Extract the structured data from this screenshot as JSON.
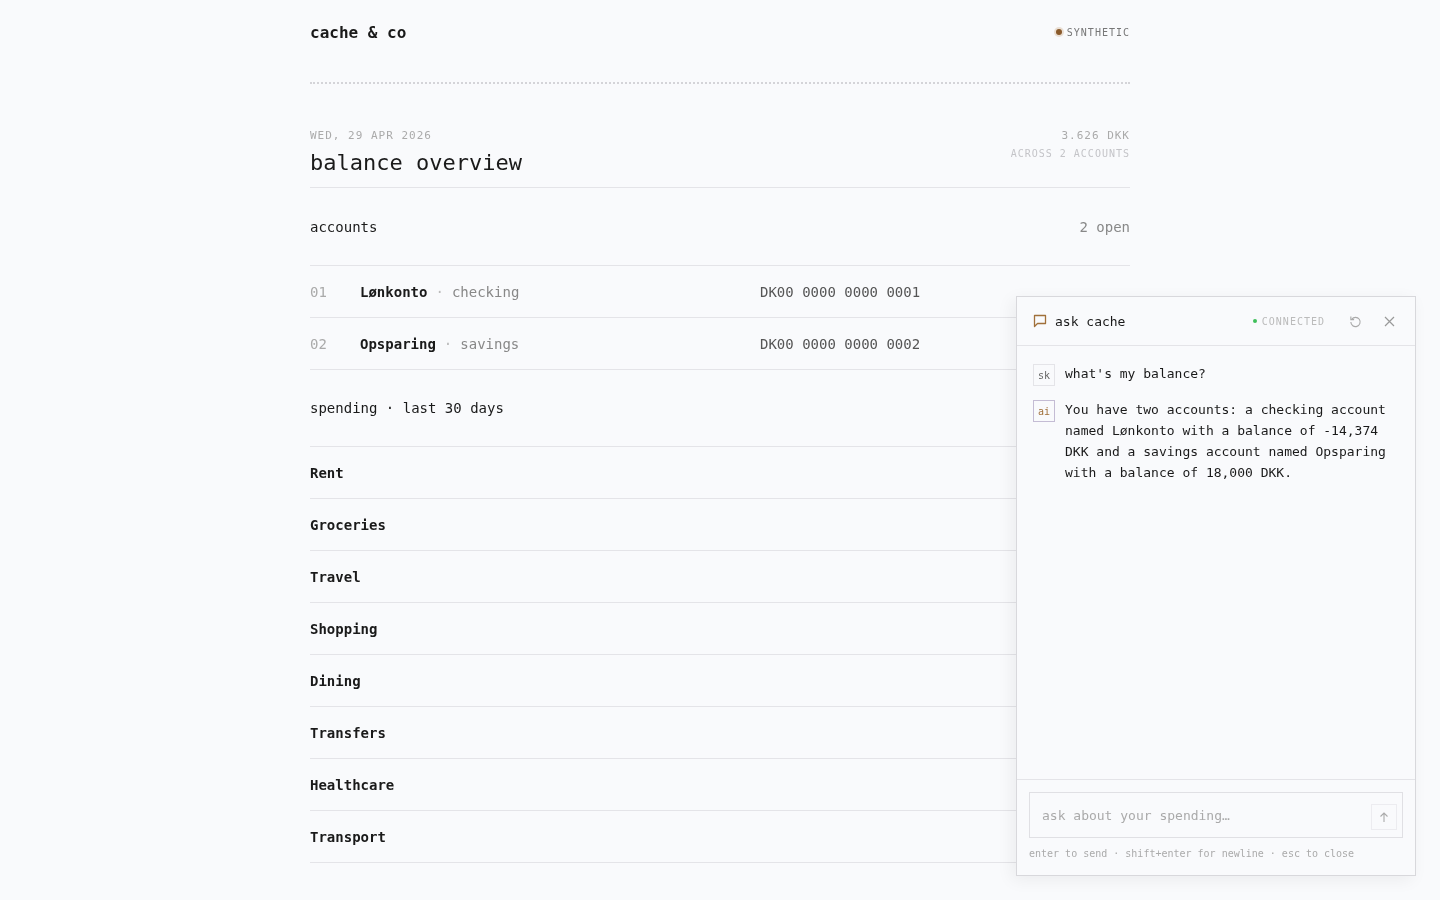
{
  "brand": "cache & co",
  "badge": {
    "label": "SYNTHETIC",
    "color": "#8a5a2b"
  },
  "header": {
    "date": "WED, 29 APR 2026",
    "title": "balance overview",
    "total": "3.626 DKK",
    "total_note": "ACROSS 2 ACCOUNTS"
  },
  "accounts": {
    "title": "accounts",
    "count": "2 open",
    "rows": [
      {
        "number": "01",
        "name": "Lønkonto",
        "separator": "·",
        "type": "checking",
        "iban": "DK00 0000 0000 0001"
      },
      {
        "number": "02",
        "name": "Opsparing",
        "separator": "·",
        "type": "savings",
        "iban": "DK00 0000 0000 0002"
      }
    ]
  },
  "spending": {
    "title": "spending · last 30 days",
    "categories": [
      "Rent",
      "Groceries",
      "Travel",
      "Shopping",
      "Dining",
      "Transfers",
      "Healthcare",
      "Transport"
    ]
  },
  "chat": {
    "title": "ask cache",
    "status": {
      "label": "CONNECTED",
      "color": "#3fbf5a"
    },
    "messages": [
      {
        "kind": "user",
        "avatar": "sk",
        "text": "what's my balance?"
      },
      {
        "kind": "assistant",
        "avatar": "ai",
        "text": "You have two accounts: a checking account named Lønkonto with a balance of -14,374 DKK and a savings account named Opsparing with a balance of 18,000 DKK."
      }
    ],
    "input": {
      "placeholder": "ask about your spending…"
    },
    "hint": "enter to send · shift+enter for newline · esc to close"
  }
}
